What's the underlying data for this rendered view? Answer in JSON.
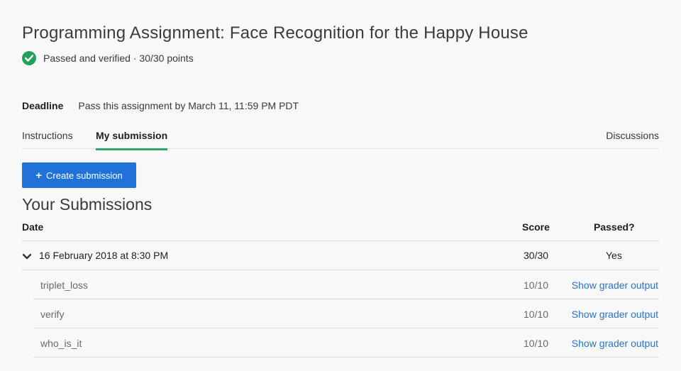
{
  "page": {
    "title": "Programming Assignment: Face Recognition for the Happy House",
    "status": "Passed and verified · 30/30 points"
  },
  "deadline": {
    "label": "Deadline",
    "text": "Pass this assignment by March 11, 11:59 PM PDT"
  },
  "tabs": {
    "instructions": "Instructions",
    "my_submission": "My submission",
    "discussions": "Discussions"
  },
  "actions": {
    "create_submission": "Create submission"
  },
  "submissions": {
    "title": "Your Submissions",
    "columns": {
      "date": "Date",
      "score": "Score",
      "passed": "Passed?"
    },
    "entry": {
      "date": "16 February 2018 at 8:30 PM",
      "score": "30/30",
      "passed": "Yes"
    },
    "parts": [
      {
        "name": "triplet_loss",
        "score": "10/10",
        "link": "Show grader output"
      },
      {
        "name": "verify",
        "score": "10/10",
        "link": "Show grader output"
      },
      {
        "name": "who_is_it",
        "score": "10/10",
        "link": "Show grader output"
      }
    ]
  },
  "colors": {
    "accent_blue": "#1f73d8",
    "pass_green": "#1fa25a",
    "tab_underline": "#2ea66a",
    "link": "#2a73cc"
  }
}
